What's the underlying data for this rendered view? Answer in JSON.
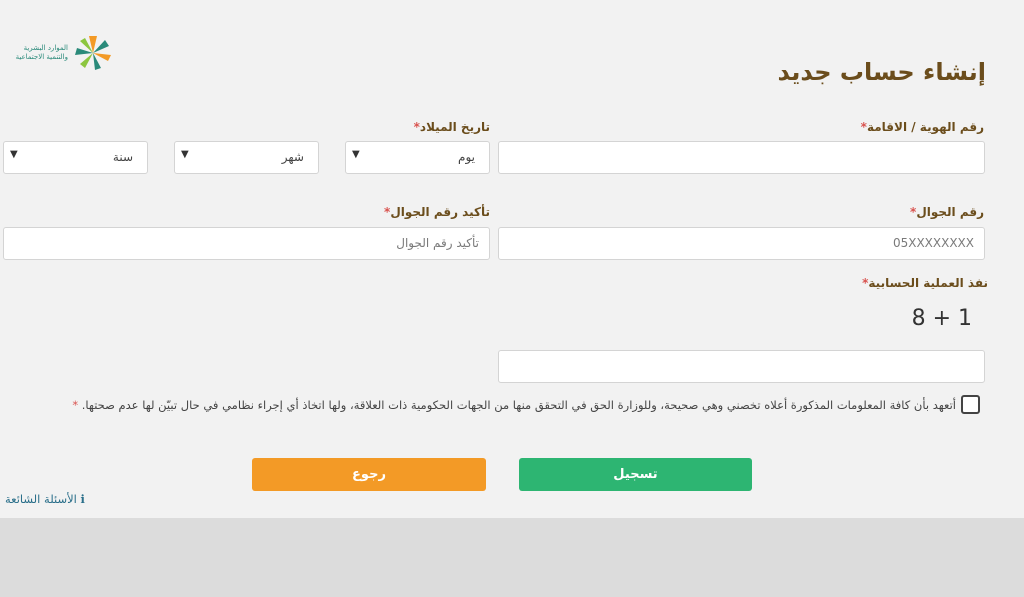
{
  "logo": {
    "text_line1": "الموارد البشرية",
    "text_line2": "والتنمية الاجتماعية"
  },
  "page_title": "إنشاء حساب جديد",
  "form": {
    "id_label": "رقم الهوية / الاقامة",
    "dob_label": "تاريخ الميلاد",
    "day_select": "يوم",
    "month_select": "شهر",
    "year_select": "سنة",
    "mobile_label": "رقم الجوال",
    "mobile_placeholder": "05XXXXXXXX",
    "confirm_mobile_label": "تأكيد رقم الجوال",
    "confirm_mobile_placeholder": "تأكيد رقم الجوال",
    "captcha_label": "نفذ العملية الحسابية",
    "captcha_question": "8 + 1",
    "required_mark": "*",
    "agreement_text": "أتعهد بأن كافة المعلومات المذكورة أعلاه تخصني وهي صحيحة، وللوزارة الحق في التحقق منها من الجهات الحكومية ذات العلاقة، ولها اتخاذ أي إجراء نظامي في حال تبيّن لها عدم صحتها."
  },
  "buttons": {
    "register": "تسجيل",
    "back": "رجوع"
  },
  "faq_link": "الأسئلة الشائعة",
  "colors": {
    "brown": "#6b4d1c",
    "green": "#2db572",
    "orange": "#f39a26",
    "required": "#d9534f"
  }
}
